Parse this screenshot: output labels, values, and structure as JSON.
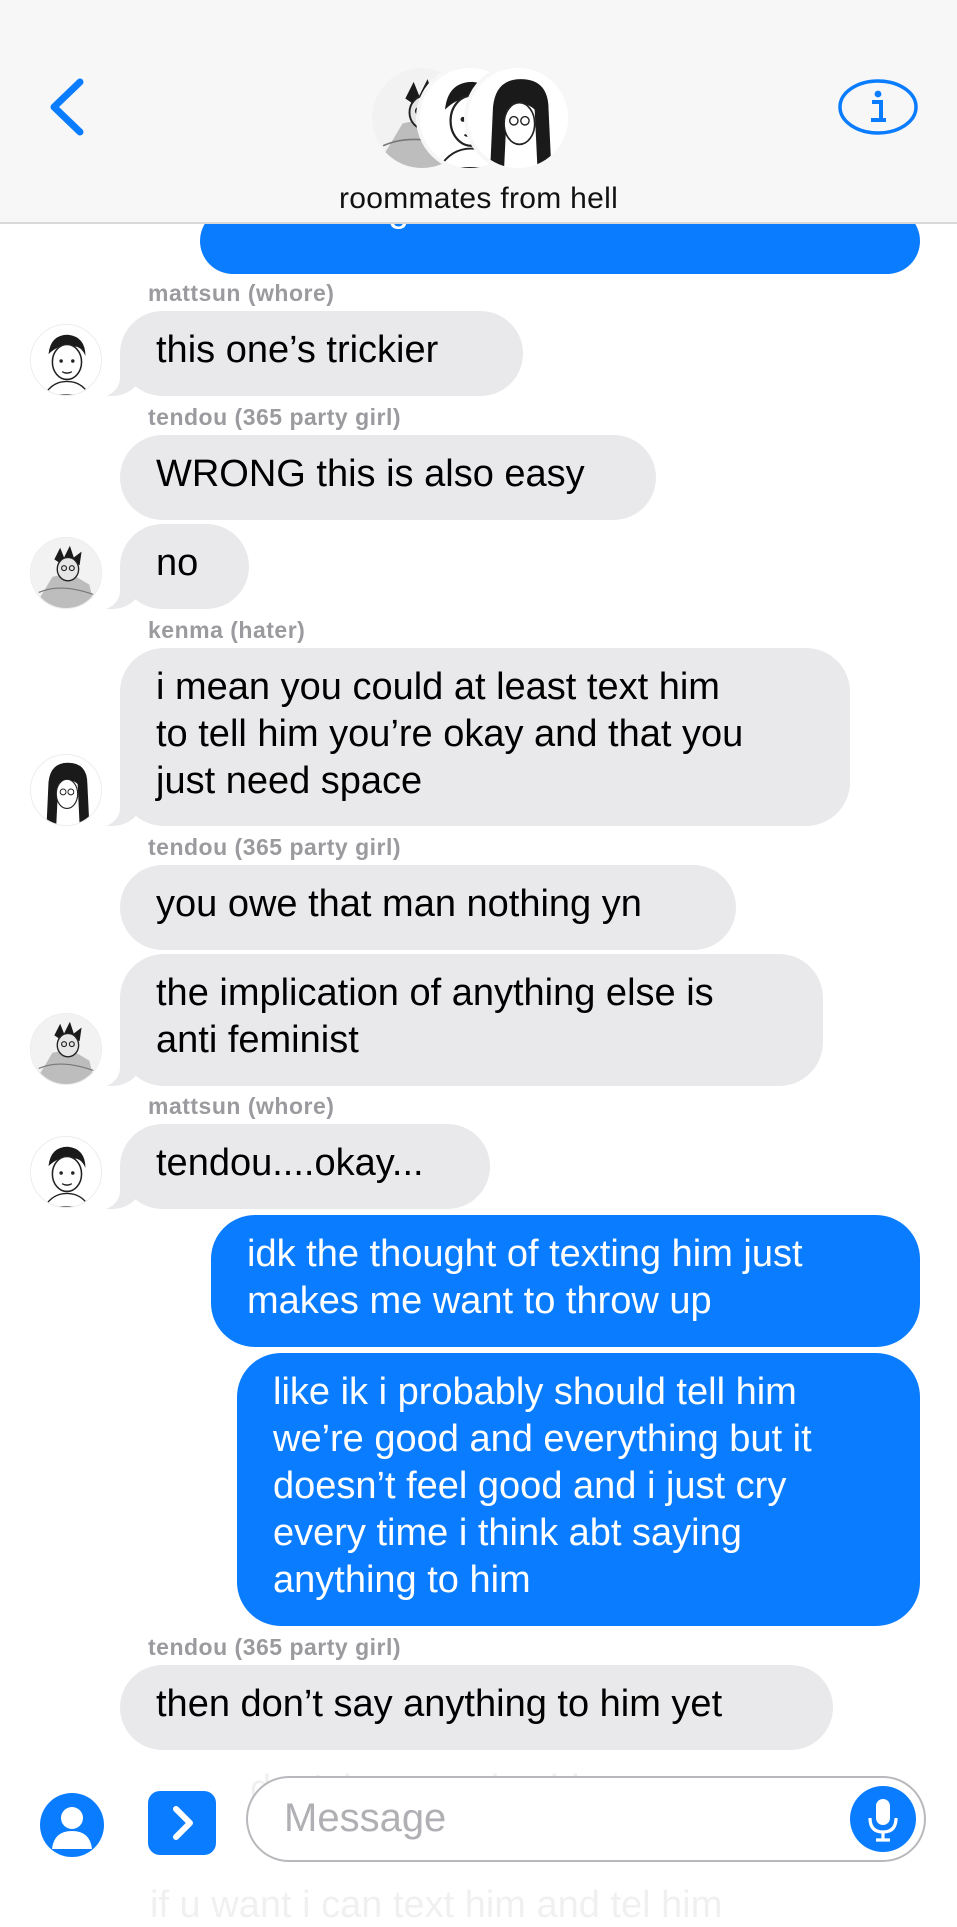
{
  "header": {
    "title": "roommates from hell",
    "back_icon": "chevron-left-icon",
    "info_icon": "info-icon",
    "accent": "#0a7cff"
  },
  "messages": {
    "m0": {
      "text": "not talking to bokuto"
    },
    "s1": "mattsun (whore)",
    "m1": {
      "text": "this one’s trickier"
    },
    "s2": "tendou (365 party girl)",
    "m2": {
      "text": "WRONG this is also easy"
    },
    "m3": {
      "text": "no"
    },
    "s4": "kenma (hater)",
    "m4": {
      "lines": [
        "i mean you could at least text him",
        "to tell him you’re okay and that you",
        "just need space"
      ]
    },
    "s5": "tendou (365 party girl)",
    "m5": {
      "text": "you owe that man nothing yn"
    },
    "m6": {
      "lines": [
        "the implication of anything else is",
        "anti feminist"
      ]
    },
    "s7": "mattsun (whore)",
    "m7": {
      "text": "tendou....okay..."
    },
    "m8": {
      "lines": [
        "idk the thought of texting him just",
        "makes me want to throw up"
      ]
    },
    "m9": {
      "lines": [
        "like ik i probably should tell him",
        "we’re good and everything but it",
        "doesn’t feel good and i just cry",
        "every time i think abt saying",
        "anything to him"
      ]
    },
    "s10": "tendou (365 party girl)",
    "m10": {
      "text": "then don’t say anything to him yet"
    },
    "m11": {
      "text": "don’t have to do shit"
    },
    "m12": {
      "text": "if u want i can text him and tel him"
    }
  },
  "composer": {
    "placeholder": "Message",
    "person_icon": "person-icon",
    "apps_icon": "chevron-right-icon",
    "mic_icon": "microphone-icon"
  },
  "colors": {
    "incoming_bubble": "#e9e9eb",
    "outgoing_bubble": "#0a7cff",
    "sender_label": "#9b9b9f"
  }
}
